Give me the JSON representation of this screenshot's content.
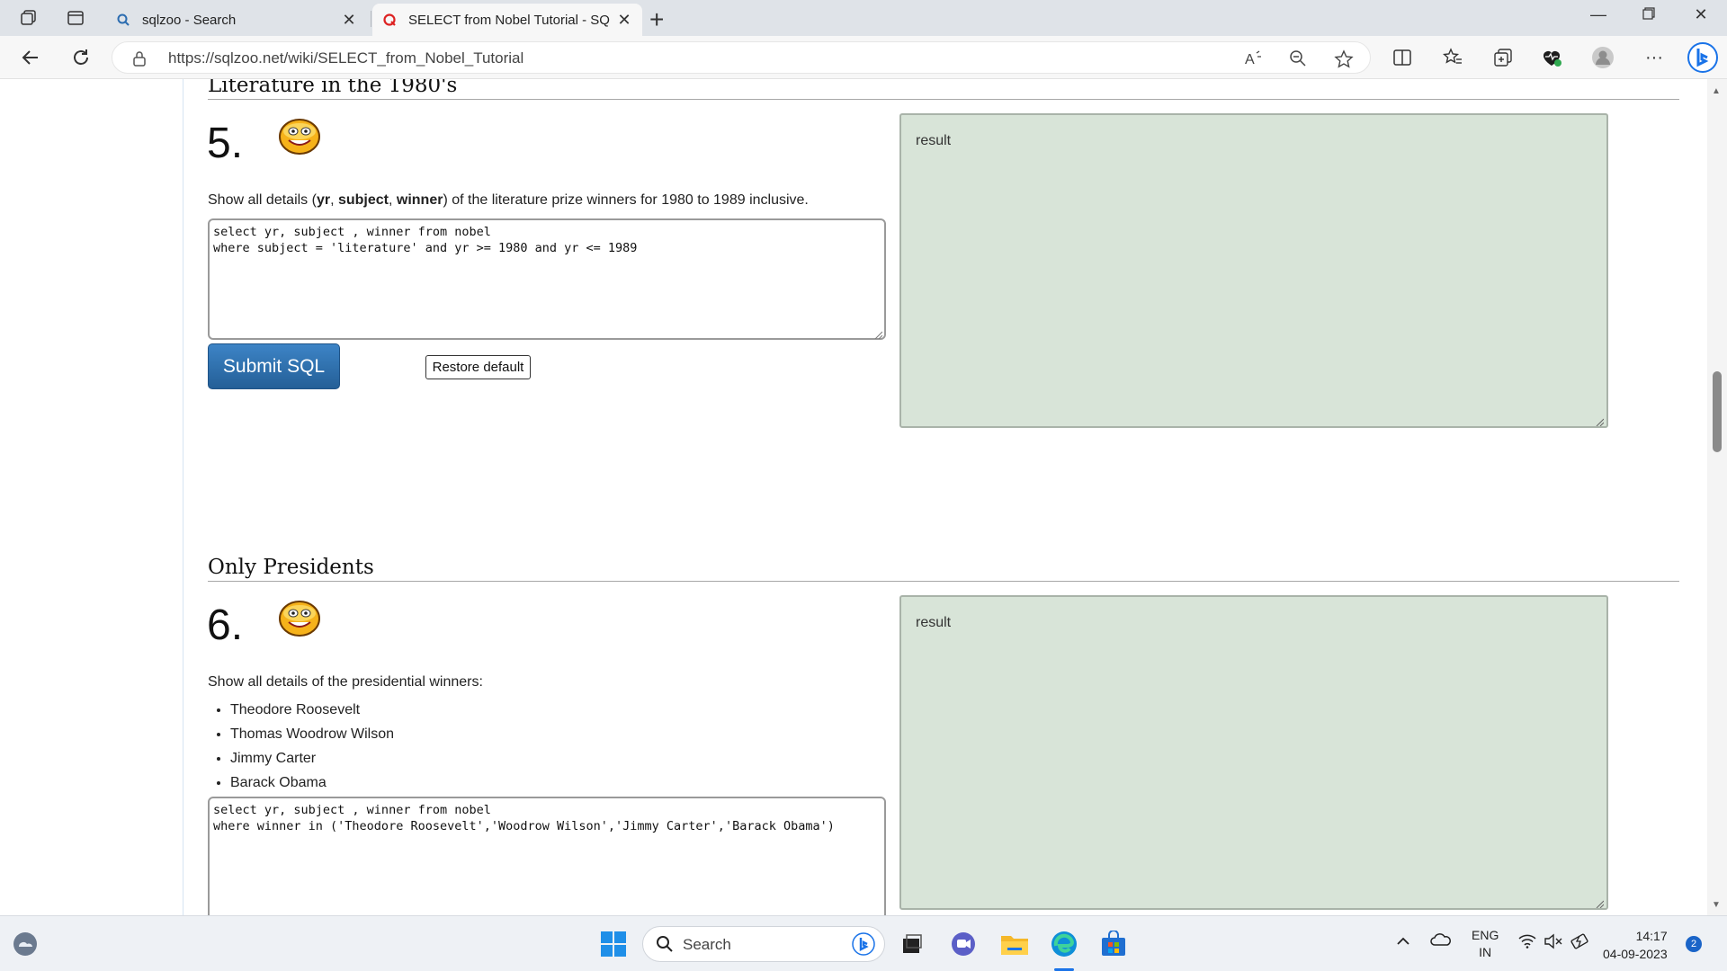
{
  "browser": {
    "tabs": [
      {
        "title": "sqlzoo - Search",
        "active": false
      },
      {
        "title": "SELECT from Nobel Tutorial - SQ",
        "active": true
      }
    ],
    "url": "https://sqlzoo.net/wiki/SELECT_from_Nobel_Tutorial"
  },
  "page": {
    "section5": {
      "heading": "Literature in the 1980's",
      "number": "5.",
      "desc_pre": "Show all details (",
      "desc_b1": "yr",
      "desc_c1": ", ",
      "desc_b2": "subject",
      "desc_c2": ", ",
      "desc_b3": "winner",
      "desc_post": ") of the literature prize winners for 1980 to 1989 inclusive.",
      "sql": "select yr, subject , winner from nobel\nwhere subject = 'literature' and yr >= 1980 and yr <= 1989",
      "submit_label": "Submit SQL",
      "restore_label": "Restore default",
      "result_label": "result"
    },
    "section6": {
      "heading": "Only Presidents",
      "number": "6.",
      "desc": "Show all details of the presidential winners:",
      "list": [
        "Theodore Roosevelt",
        "Thomas Woodrow Wilson",
        "Jimmy Carter",
        "Barack Obama"
      ],
      "sql": "select yr, subject , winner from nobel\nwhere winner in ('Theodore Roosevelt','Woodrow Wilson','Jimmy Carter','Barack Obama')",
      "result_label": "result"
    }
  },
  "taskbar": {
    "search_placeholder": "Search",
    "lang_top": "ENG",
    "lang_bottom": "IN",
    "time": "14:17",
    "date": "04-09-2023",
    "notification_count": "2"
  },
  "colors": {
    "result_bg": "#d8e4d8",
    "submit_bg": "#2f6fad",
    "tab_strip": "#dfe3e8"
  }
}
